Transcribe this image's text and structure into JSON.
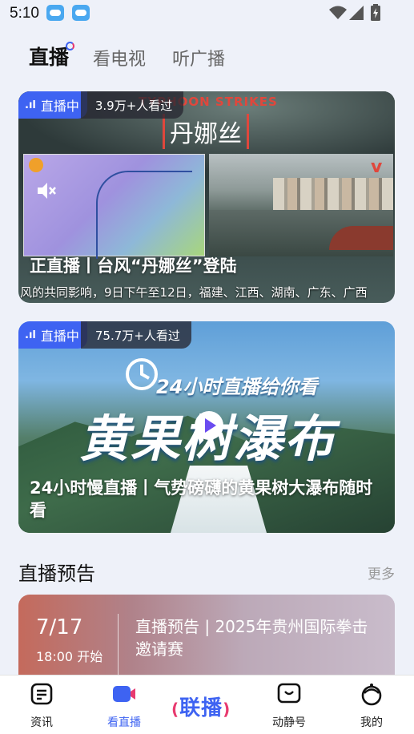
{
  "status_bar": {
    "time": "5:10"
  },
  "tabs": [
    {
      "label": "直播",
      "active": true
    },
    {
      "label": "看电视",
      "active": false
    },
    {
      "label": "听广播",
      "active": false
    }
  ],
  "live_cards": [
    {
      "badge": "直播中",
      "viewers": "3.9万+人看过",
      "title": "正直播丨台风“丹娜丝”登陆",
      "ticker": "风的共同影响，9日下午至12日，福建、江西、湖南、广东、广西",
      "overlay_banner": "TYPHOON STRIKES",
      "overlay_name": "丹娜丝"
    },
    {
      "badge": "直播中",
      "viewers": "75.7万+人看过",
      "title": "24小时慢直播丨气势磅礴的黄果树大瀑布随时看",
      "overlay_small": "24小时直播给你看",
      "overlay_big": "黄果树瀑布"
    }
  ],
  "schedule_section": {
    "title": "直播预告",
    "more": "更多"
  },
  "preview": {
    "date": "7/17",
    "time": "18:00 开始",
    "title": "直播预告 | 2025年贵州国际拳击邀请赛"
  },
  "bottom_nav": {
    "items": [
      {
        "label": "资讯",
        "icon": "news-icon",
        "active": false
      },
      {
        "label": "看直播",
        "icon": "live-video-icon",
        "active": true
      },
      {
        "label": "联播",
        "icon": "lianbo-logo",
        "active": false
      },
      {
        "label": "动静号",
        "icon": "tv-face-icon",
        "active": false
      },
      {
        "label": "我的",
        "icon": "profile-icon",
        "active": false
      }
    ]
  },
  "colors": {
    "accent": "#3e63f2",
    "accent_pink": "#e83a6f",
    "background": "#eef1f9"
  }
}
